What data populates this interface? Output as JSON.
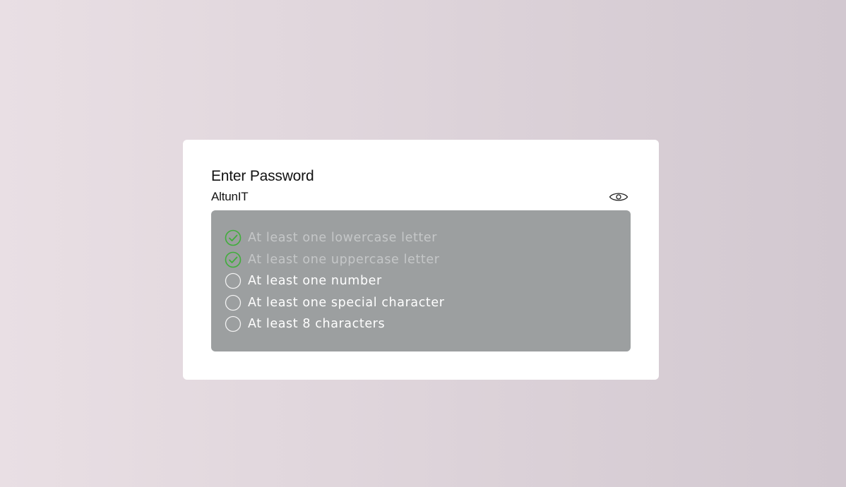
{
  "form": {
    "title": "Enter Password",
    "password_value": "AltunIT",
    "visibility_icon": "eye-icon"
  },
  "rules": [
    {
      "label": "At least one lowercase letter",
      "met": true,
      "icon": "check-badge-icon"
    },
    {
      "label": "At least one uppercase letter",
      "met": true,
      "icon": "check-badge-icon"
    },
    {
      "label": "At least one number",
      "met": false,
      "icon": "empty-circle-icon"
    },
    {
      "label": "At least one special character",
      "met": false,
      "icon": "empty-circle-icon"
    },
    {
      "label": "At least 8 characters",
      "met": false,
      "icon": "empty-circle-icon"
    }
  ],
  "colors": {
    "met_icon": "#3fae3a",
    "met_text": "#c5c7c8",
    "unmet_text": "#ffffff",
    "panel_bg": "#9c9fa0"
  }
}
